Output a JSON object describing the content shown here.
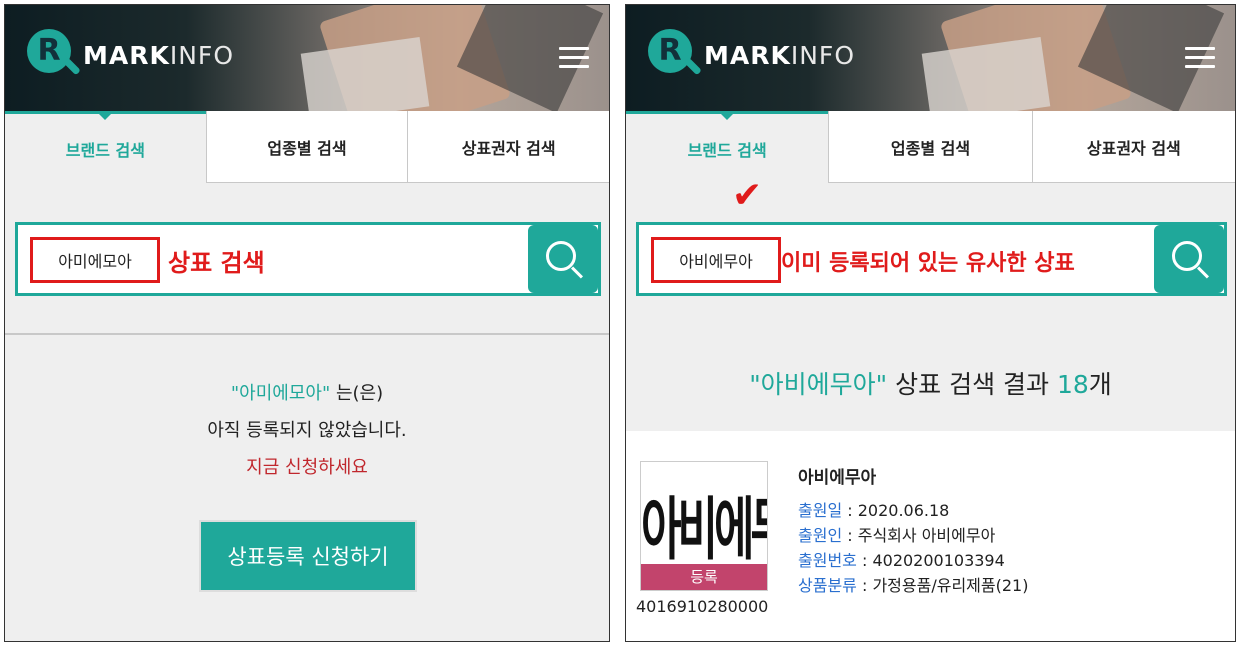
{
  "logo": {
    "mark": "R",
    "brand_bold": "MARK",
    "brand_light": "INFO"
  },
  "tabs": [
    "브랜드 검색",
    "업종별 검색",
    "상표권자 검색"
  ],
  "left": {
    "search_value": "아미에모아",
    "annotation": "상표 검색",
    "message": {
      "quoted": "\"아미에모아\"",
      "suffix": " 는(은)",
      "line2": "아직 등록되지 않았습니다.",
      "line3": "지금 신청하세요"
    },
    "apply_button": "상표등록 신청하기"
  },
  "right": {
    "check_mark": "✔",
    "search_value": "아비에무아",
    "annotation": "이미 등록되어 있는 유사한 상표",
    "results": {
      "quoted": "\"아비에무아\"",
      "middle": " 상표 검색 결과 ",
      "count": "18",
      "suffix": "개"
    },
    "item": {
      "thumb_text": "아비에무아",
      "status": "등록",
      "reg_number": "4016910280000",
      "name": "아비에무아",
      "fields": [
        {
          "label": "출원일",
          "value": " : 2020.06.18"
        },
        {
          "label": "출원인",
          "value": " : 주식회사 아비에무아"
        },
        {
          "label": "출원번호",
          "value": " : 4020200103394"
        },
        {
          "label": "상품분류",
          "value": " : 가정용품/유리제품(21)"
        }
      ]
    }
  },
  "colors": {
    "accent": "#1fa89a",
    "annotation_red": "#e01b1b",
    "badge": "#c2446c",
    "link_blue": "#2a6fcf"
  }
}
